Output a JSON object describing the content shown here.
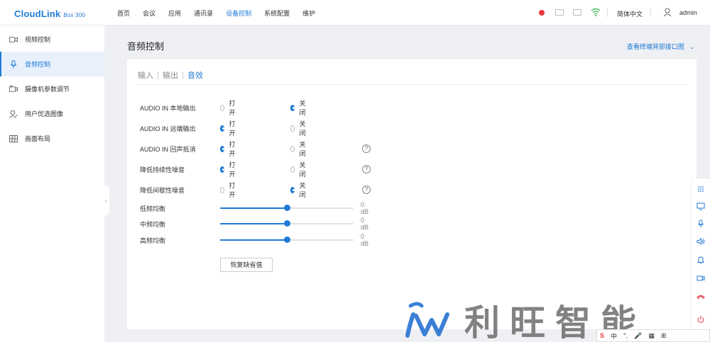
{
  "header": {
    "brand": "CloudLink",
    "model": "Box 300",
    "nav": [
      {
        "label": "首页",
        "active": false
      },
      {
        "label": "会议",
        "active": false
      },
      {
        "label": "应用",
        "active": false
      },
      {
        "label": "通讯录",
        "active": false
      },
      {
        "label": "设备控制",
        "active": true
      },
      {
        "label": "系统配置",
        "active": false
      },
      {
        "label": "维护",
        "active": false
      }
    ],
    "language": "简体中文",
    "user": "admin",
    "accent_color": "#1f7ad6",
    "status_dot_color": "#e8353b"
  },
  "sidebar": {
    "items": [
      {
        "label": "视频控制",
        "icon": "video-icon",
        "active": false
      },
      {
        "label": "音频控制",
        "icon": "microphone-icon",
        "active": true
      },
      {
        "label": "摄像机参数调节",
        "icon": "camera-icon",
        "active": false
      },
      {
        "label": "用户优选图像",
        "icon": "user-icon",
        "active": false
      },
      {
        "label": "画面布局",
        "icon": "grid-icon",
        "active": false
      }
    ],
    "collapse_glyph": "‹"
  },
  "main": {
    "title": "音频控制",
    "link": "查看终端背部接口图",
    "tabs": [
      {
        "label": "输入",
        "active": false
      },
      {
        "label": "输出",
        "active": false
      },
      {
        "label": "音效",
        "active": true
      }
    ],
    "on_label": "打开",
    "off_label": "关闭",
    "settings": [
      {
        "label": "AUDIO IN 本地输出",
        "value": "off",
        "help": false
      },
      {
        "label": "AUDIO IN 远端输出",
        "value": "on",
        "help": false
      },
      {
        "label": "AUDIO IN 回声抵消",
        "value": "on",
        "help": true
      },
      {
        "label": "降低持续性噪音",
        "value": "on",
        "help": true
      },
      {
        "label": "降低间歇性噪音",
        "value": "off",
        "help": true
      }
    ],
    "help_glyph": "?",
    "equalizer": [
      {
        "label": "低频均衡",
        "value_text": "0 dB",
        "level": 0.5
      },
      {
        "label": "中频均衡",
        "value_text": "0 dB",
        "level": 0.5
      },
      {
        "label": "高频均衡",
        "value_text": "0 dB",
        "level": 0.5
      }
    ],
    "reset_label": "恢复缺省值"
  },
  "watermark": {
    "text": "利旺智能",
    "logo_color": "#3a7fd5"
  },
  "ime": {
    "items": [
      "中",
      "°,",
      "🎤",
      "▦",
      "⊞"
    ]
  }
}
